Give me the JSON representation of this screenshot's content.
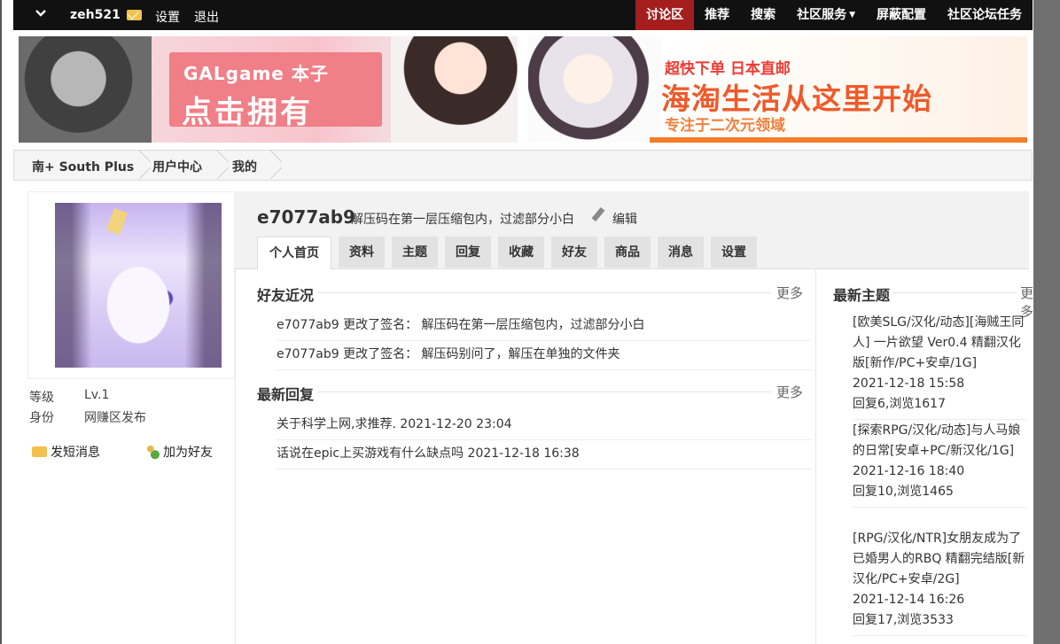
{
  "topbar": {
    "username": "zeh521",
    "links": [
      "设置",
      "退出"
    ],
    "nav": [
      {
        "label": "讨论区",
        "active": true,
        "caret": false
      },
      {
        "label": "推荐",
        "active": false,
        "caret": false
      },
      {
        "label": "搜索",
        "active": false,
        "caret": false
      },
      {
        "label": "社区服务",
        "active": false,
        "caret": true
      },
      {
        "label": "屏蔽配置",
        "active": false,
        "caret": false
      },
      {
        "label": "社区论坛任务",
        "active": false,
        "caret": false
      }
    ],
    "caret_glyph": "▼"
  },
  "banners": {
    "left": {
      "line1": "GALgame  本子",
      "line2": "点击拥有"
    },
    "right": {
      "line1": "超快下单 日本直邮",
      "line2": "海淘生活从这里开始",
      "line3": "专注于二次元领域"
    }
  },
  "breadcrumb": [
    "南+ South Plus",
    "用户中心",
    "我的"
  ],
  "profile": {
    "level_label": "等级",
    "level_value": "Lv.1",
    "role_label": "身份",
    "role_value": "网赚区发布",
    "send_message": "发短消息",
    "add_friend": "加为好友"
  },
  "header": {
    "username": "e7077ab9",
    "signature": "解压码在第一层压缩包内，过滤部分小白",
    "edit_label": "编辑"
  },
  "tabs": [
    "个人首页",
    "资料",
    "主题",
    "回复",
    "收藏",
    "好友",
    "商品",
    "消息",
    "设置"
  ],
  "friends_feed": {
    "title": "好友近况",
    "more": "更多",
    "items": [
      "e7077ab9 更改了签名：  解压码在第一层压缩包内，过滤部分小白",
      "e7077ab9 更改了签名：  解压码别问了，解压在单独的文件夹"
    ]
  },
  "recent_replies": {
    "title": "最新回复",
    "more": "更多",
    "items": [
      "关于科学上网,求推荐. 2021-12-20 23:04",
      "话说在epic上买游戏有什么缺点吗 2021-12-18 16:38"
    ]
  },
  "latest_threads": {
    "title": "最新主题",
    "more": "更多",
    "items": [
      {
        "title": "[欧美SLG/汉化/动态][海贼王同人] 一片欲望 Ver0.4 精翻汉化版[新作/PC+安卓/1G]",
        "date": "2021-12-18 15:58",
        "stats": "回复6,浏览1617"
      },
      {
        "title": "[探索RPG/汉化/动态]与人马娘的日常[安卓+PC/新汉化/1G]",
        "date": "2021-12-16 18:40",
        "stats": "回复10,浏览1465"
      },
      {
        "title": "[RPG/汉化/NTR]女朋友成为了已婚男人的RBQ 精翻完结版[新汉化/PC+安卓/2G]",
        "date": "2021-12-14 16:26",
        "stats": "回复17,浏览3533"
      }
    ]
  },
  "colors": {
    "topbar": "#111111",
    "active_nav": "#a41e1e",
    "accent_orange": "#ee5a2a"
  }
}
